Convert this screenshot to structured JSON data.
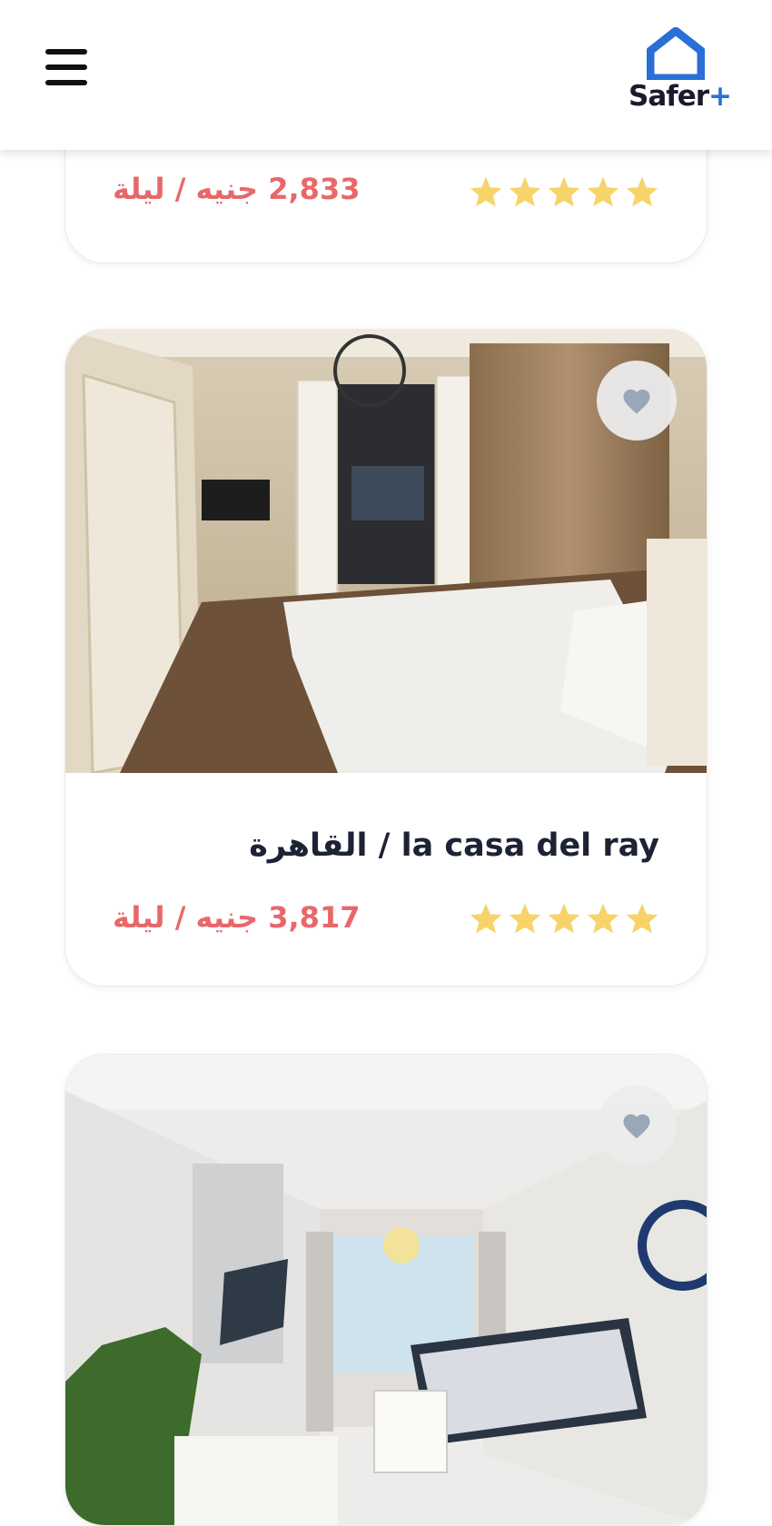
{
  "header": {
    "menu_icon": "hamburger-menu-icon",
    "logo_icon": "house-icon",
    "logo_text": "Safer",
    "logo_plus": "+",
    "brand_color": "#2a6fd6"
  },
  "listings": [
    {
      "title": "",
      "price": "2,833 جنيه / ليلة",
      "rating": 5,
      "favorite_icon": "heart-icon"
    },
    {
      "title": "la casa del ray / القاهرة",
      "price": "3,817 جنيه / ليلة",
      "rating": 5,
      "favorite_icon": "heart-icon"
    },
    {
      "title": "",
      "price": "",
      "rating": 0,
      "favorite_icon": "heart-icon"
    }
  ],
  "colors": {
    "price": "#e8686a",
    "star": "#f7d36a",
    "title": "#1e2235"
  }
}
